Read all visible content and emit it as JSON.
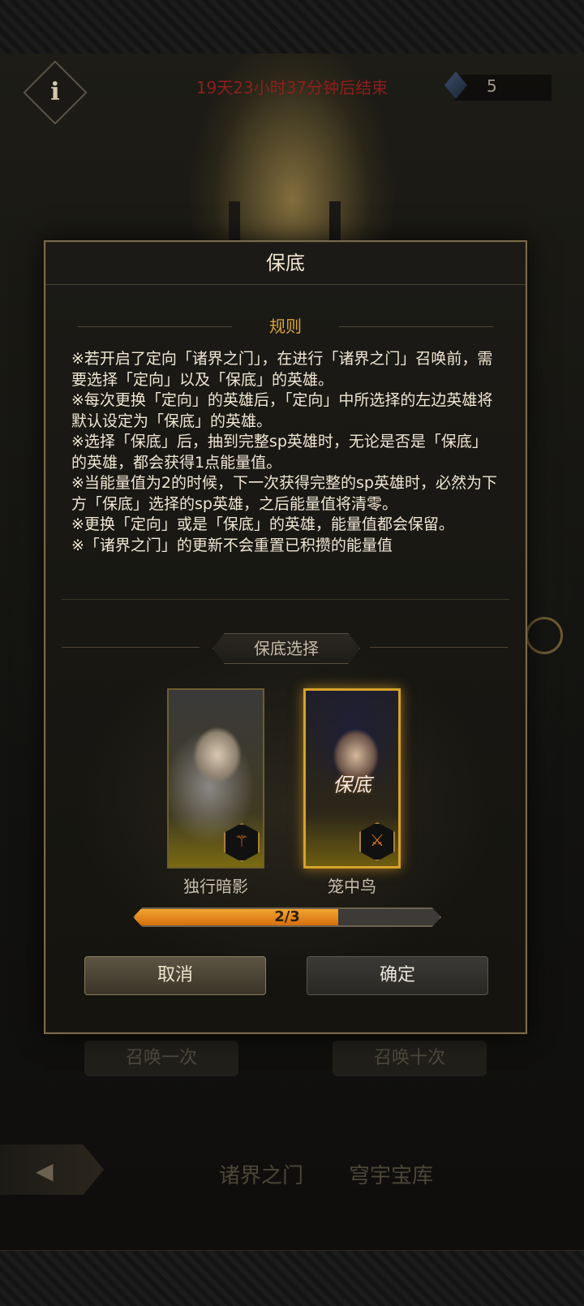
{
  "background": {
    "countdown": "19天23小时37分钟后结束",
    "currency_value": "5",
    "summon_once": "召唤一次",
    "summon_ten": "召唤十次",
    "tabs": [
      "诸界之门",
      "穹宇宝库"
    ]
  },
  "modal": {
    "title": "保底",
    "rules_heading": "规则",
    "rules_text": "※若开启了定向「诸界之门」，在进行「诸界之门」召唤前，需要选择「定向」以及「保底」的英雄。\n※每次更换「定向」的英雄后，「定向」中所选择的左边英雄将默认设定为「保底」的英雄。\n※选择「保底」后，抽到完整sp英雄时，无论是否是「保底」的英雄，都会获得1点能量值。\n※当能量值为2的时候，下一次获得完整的sp英雄时，必然为下方「保底」选择的sp英雄，之后能量值将清零。\n※更换「定向」或是「保底」的英雄，能量值都会保留。\n※「诸界之门」的更新不会重置已积攒的能量值",
    "pity_selection_title": "保底选择",
    "heroes": [
      {
        "name": "独行暗影",
        "selected": false
      },
      {
        "name": "笼中鸟",
        "selected": true,
        "tag": "保底"
      }
    ],
    "progress": {
      "label": "2/3",
      "current": 2,
      "total": 3
    },
    "cancel_label": "取消",
    "confirm_label": "确定"
  },
  "colors": {
    "accent_gold": "#d9a33c",
    "progress_orange": "#f2a531",
    "countdown_red": "#8e1f1f"
  }
}
